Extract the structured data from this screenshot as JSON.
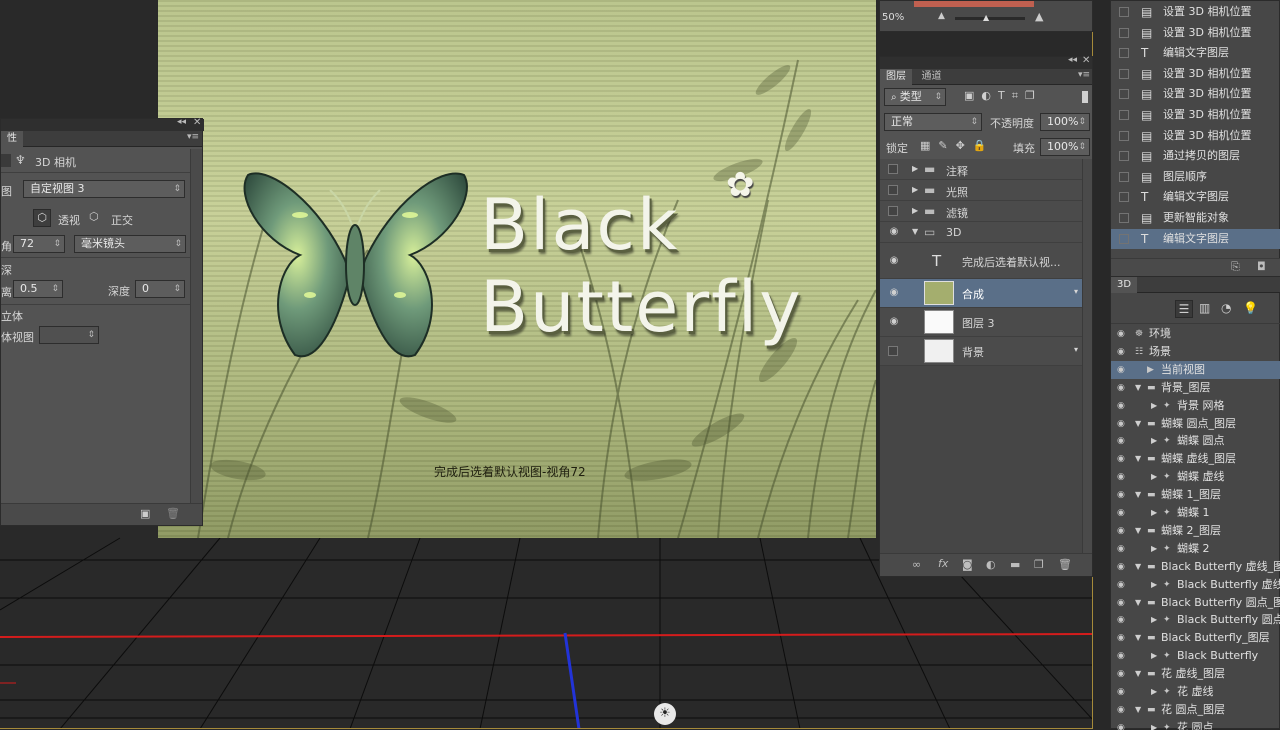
{
  "canvas": {
    "title_line1": "Black",
    "title_line2": "Butterfly",
    "caption": "完成后选着默认视图-视角72"
  },
  "top_strip": {
    "zoom": "50%"
  },
  "properties_panel": {
    "tab_label": "性",
    "header": "3D 相机",
    "view_label": "图",
    "view_value": "自定视图 3",
    "perspective": "透视",
    "orthographic": "正交",
    "fov_label": "角",
    "fov_value": "72",
    "lens_value": "毫米镜头",
    "dof_section": "深",
    "distance_label": "离",
    "distance_value": "0.5",
    "depth_label": "深度",
    "depth_value": "0",
    "stereo_section": "立体",
    "stereo_view_label": "体视图"
  },
  "layers_panel": {
    "tabs": [
      "图层",
      "通道"
    ],
    "filter_kind": "类型",
    "blend_mode": "正常",
    "opacity_label": "不透明度",
    "opacity_value": "100%",
    "lock_label": "锁定",
    "fill_label": "填充",
    "fill_value": "100%",
    "layers": [
      {
        "name": "注释",
        "type": "group",
        "visible": false
      },
      {
        "name": "光照",
        "type": "group",
        "visible": false
      },
      {
        "name": "滤镜",
        "type": "group",
        "visible": false
      },
      {
        "name": "3D",
        "type": "group-open",
        "visible": true
      },
      {
        "name": "完成后选着默认视...",
        "type": "text",
        "visible": true
      },
      {
        "name": "合成",
        "type": "3d",
        "visible": true,
        "selected": true
      },
      {
        "name": "图层 3",
        "type": "pixel",
        "visible": true
      },
      {
        "name": "背景",
        "type": "3d",
        "visible": false
      }
    ]
  },
  "history_panel": {
    "items": [
      {
        "label": "设置 3D 相机位置",
        "icon": "doc"
      },
      {
        "label": "设置 3D 相机位置",
        "icon": "doc"
      },
      {
        "label": "编辑文字图层",
        "icon": "T"
      },
      {
        "label": "设置 3D 相机位置",
        "icon": "doc"
      },
      {
        "label": "设置 3D 相机位置",
        "icon": "doc"
      },
      {
        "label": "设置 3D 相机位置",
        "icon": "doc"
      },
      {
        "label": "设置 3D 相机位置",
        "icon": "doc"
      },
      {
        "label": "通过拷贝的图层",
        "icon": "doc"
      },
      {
        "label": "图层顺序",
        "icon": "doc"
      },
      {
        "label": "编辑文字图层",
        "icon": "T"
      },
      {
        "label": "更新智能对象",
        "icon": "doc"
      },
      {
        "label": "编辑文字图层",
        "icon": "T",
        "selected": true
      }
    ]
  },
  "scene_panel": {
    "tab": "3D",
    "items": [
      {
        "label": "环境",
        "indent": 1,
        "kind": "env"
      },
      {
        "label": "场景",
        "indent": 1,
        "kind": "scene"
      },
      {
        "label": "当前视图",
        "indent": 2,
        "kind": "camera",
        "selected": true
      },
      {
        "label": "背景_图层",
        "indent": 1,
        "kind": "group"
      },
      {
        "label": "背景 网格",
        "indent": 3,
        "kind": "mesh"
      },
      {
        "label": "蝴蝶 圆点_图层",
        "indent": 1,
        "kind": "group"
      },
      {
        "label": "蝴蝶 圆点",
        "indent": 3,
        "kind": "mesh"
      },
      {
        "label": "蝴蝶 虚线_图层",
        "indent": 1,
        "kind": "group"
      },
      {
        "label": "蝴蝶 虚线",
        "indent": 3,
        "kind": "mesh"
      },
      {
        "label": "蝴蝶 1_图层",
        "indent": 1,
        "kind": "group"
      },
      {
        "label": "蝴蝶 1",
        "indent": 3,
        "kind": "mesh"
      },
      {
        "label": "蝴蝶 2_图层",
        "indent": 1,
        "kind": "group"
      },
      {
        "label": "蝴蝶 2",
        "indent": 3,
        "kind": "mesh"
      },
      {
        "label": "Black Butterfly 虚线_图层",
        "indent": 1,
        "kind": "group"
      },
      {
        "label": "Black Butterfly 虚线",
        "indent": 3,
        "kind": "mesh"
      },
      {
        "label": "Black Butterfly 圆点_图层",
        "indent": 1,
        "kind": "group"
      },
      {
        "label": "Black Butterfly 圆点",
        "indent": 3,
        "kind": "mesh"
      },
      {
        "label": "Black Butterfly_图层",
        "indent": 1,
        "kind": "group"
      },
      {
        "label": "Black Butterfly",
        "indent": 3,
        "kind": "mesh"
      },
      {
        "label": "花 虚线_图层",
        "indent": 1,
        "kind": "group"
      },
      {
        "label": "花 虚线",
        "indent": 3,
        "kind": "mesh"
      },
      {
        "label": "花 圆点_图层",
        "indent": 1,
        "kind": "group"
      },
      {
        "label": "花 圆点",
        "indent": 3,
        "kind": "mesh"
      }
    ]
  }
}
